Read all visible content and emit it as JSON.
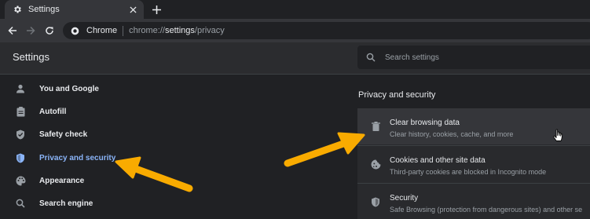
{
  "browser": {
    "tab": {
      "title": "Settings"
    },
    "omnibox": {
      "origin": "Chrome",
      "url_prefix": "chrome://",
      "url_strong": "settings",
      "url_suffix": "/privacy"
    }
  },
  "settings": {
    "title": "Settings",
    "search_placeholder": "Search settings"
  },
  "sidebar": {
    "items": [
      {
        "label": "You and Google",
        "icon": "person-icon"
      },
      {
        "label": "Autofill",
        "icon": "clipboard-icon"
      },
      {
        "label": "Safety check",
        "icon": "shield-check-icon"
      },
      {
        "label": "Privacy and security",
        "icon": "shield-icon",
        "active": true
      },
      {
        "label": "Appearance",
        "icon": "palette-icon"
      },
      {
        "label": "Search engine",
        "icon": "search-icon"
      }
    ]
  },
  "main": {
    "section_title": "Privacy and security",
    "rows": [
      {
        "title": "Clear browsing data",
        "description": "Clear history, cookies, cache, and more",
        "icon": "trash-icon"
      },
      {
        "title": "Cookies and other site data",
        "description": "Third-party cookies are blocked in Incognito mode",
        "icon": "cookie-icon"
      },
      {
        "title": "Security",
        "description": "Safe Browsing (protection from dangerous sites) and other se",
        "icon": "shield-lock-icon"
      }
    ]
  },
  "colors": {
    "accent": "#8ab4f8",
    "annotation_arrow": "#f9ab00",
    "background": "#202124"
  }
}
